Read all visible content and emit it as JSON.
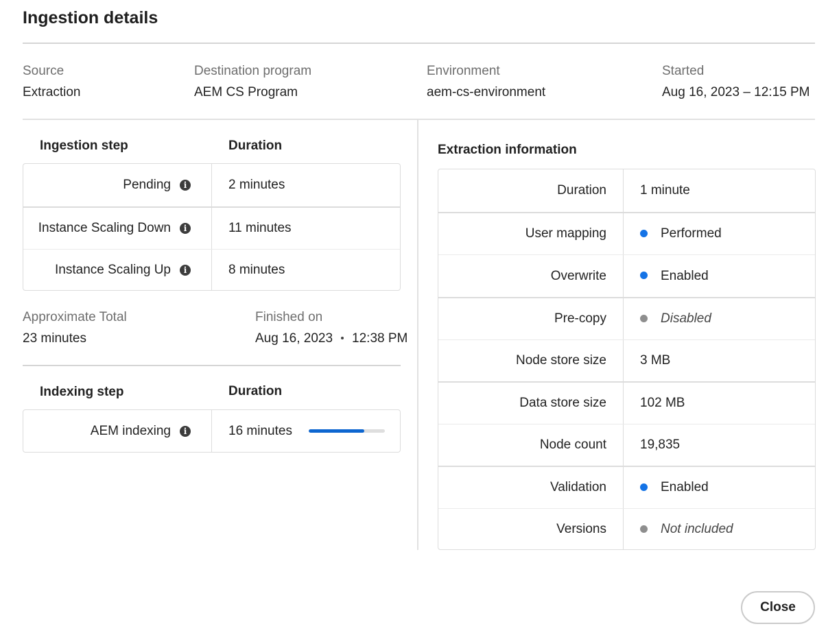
{
  "dialog": {
    "title": "Ingestion details",
    "close_label": "Close"
  },
  "meta": {
    "source_label": "Source",
    "source_value": "Extraction",
    "destination_label": "Destination program",
    "destination_value": "AEM CS Program",
    "environment_label": "Environment",
    "environment_value": "aem-cs-environment",
    "started_label": "Started",
    "started_value": "Aug 16, 2023 – 12:15 PM"
  },
  "ingestion": {
    "step_header": "Ingestion step",
    "duration_header": "Duration",
    "rows": [
      {
        "step": "Pending",
        "duration": "2 minutes"
      },
      {
        "step": "Instance Scaling Down",
        "duration": "11 minutes"
      },
      {
        "step": "Instance Scaling Up",
        "duration": "8 minutes"
      }
    ],
    "total_label": "Approximate Total",
    "total_value": "23 minutes",
    "finished_label": "Finished on",
    "finished_date": "Aug 16, 2023",
    "finished_time": "12:38 PM"
  },
  "indexing": {
    "step_header": "Indexing step",
    "duration_header": "Duration",
    "rows": [
      {
        "step": "AEM indexing",
        "duration": "16 minutes",
        "progress": 0.73
      }
    ]
  },
  "extraction": {
    "title": "Extraction information",
    "rows": [
      {
        "label": "Duration",
        "value": "1 minute"
      },
      {
        "label": "User mapping",
        "value": "Performed",
        "status": "blue"
      },
      {
        "label": "Overwrite",
        "value": "Enabled",
        "status": "blue"
      },
      {
        "label": "Pre-copy",
        "value": "Disabled",
        "status": "gray"
      },
      {
        "label": "Node store size",
        "value": "3 MB"
      },
      {
        "label": "Data store size",
        "value": "102 MB"
      },
      {
        "label": "Node count",
        "value": "19,835"
      },
      {
        "label": "Validation",
        "value": "Enabled",
        "status": "blue"
      },
      {
        "label": "Versions",
        "value": "Not included",
        "status": "gray"
      }
    ]
  },
  "icons": {
    "info": "info-icon",
    "status_dot": "status-dot-icon"
  },
  "colors": {
    "accent_blue": "#1473e6",
    "progress_fill": "#0d66d0",
    "status_gray": "#8e8e8e"
  }
}
